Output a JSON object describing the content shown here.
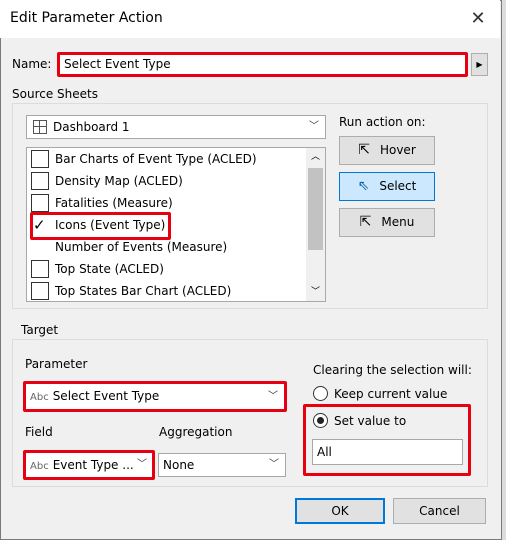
{
  "window": {
    "title": "Edit Parameter Action"
  },
  "name_field": {
    "label": "Name:",
    "value": "Select Event Type"
  },
  "source_sheets": {
    "label": "Source Sheets",
    "dashboard": "Dashboard 1",
    "sheets": [
      {
        "label": "Bar Charts of Event Type (ACLED)",
        "checked": false
      },
      {
        "label": "Density Map (ACLED)",
        "checked": false
      },
      {
        "label": "Fatalities (Measure)",
        "checked": false
      },
      {
        "label": "Icons (Event Type)",
        "checked": true
      },
      {
        "label": "Number of Events (Measure)",
        "checked": false
      },
      {
        "label": "Top State (ACLED)",
        "checked": false
      },
      {
        "label": "Top States Bar Chart (ACLED)",
        "checked": false
      }
    ]
  },
  "run_action": {
    "label": "Run action on:",
    "hover": "Hover",
    "select": "Select",
    "menu": "Menu",
    "selected": "Select"
  },
  "target": {
    "label": "Target",
    "parameter_label": "Parameter",
    "parameter_type": "Abc",
    "parameter_value": "Select Event Type",
    "field_label": "Field",
    "field_type": "Abc",
    "field_value": "Event Type ...",
    "aggregation_label": "Aggregation",
    "aggregation_value": "None"
  },
  "clearing": {
    "label": "Clearing the selection will:",
    "keep_label": "Keep current value",
    "set_label": "Set value to",
    "selected": "set",
    "value": "All"
  },
  "footer": {
    "ok": "OK",
    "cancel": "Cancel"
  },
  "colors": {
    "highlight": "#e60012",
    "selected_button": "#cce8ff",
    "focus": "#0078d7"
  }
}
